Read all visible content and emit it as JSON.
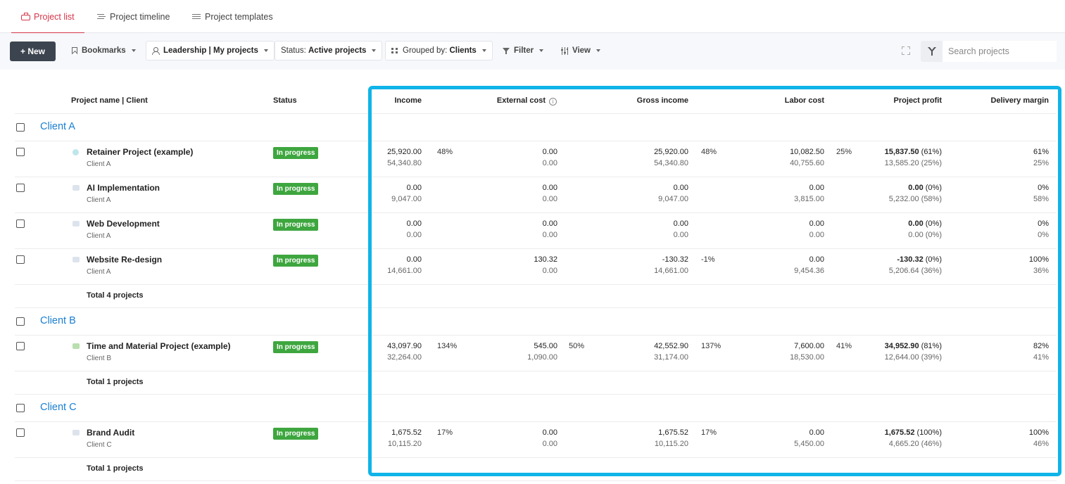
{
  "tabs": [
    {
      "label": "Project list",
      "icon": "briefcase-icon",
      "active": true
    },
    {
      "label": "Project timeline",
      "icon": "timeline-icon",
      "active": false
    },
    {
      "label": "Project templates",
      "icon": "list-icon",
      "active": false
    }
  ],
  "toolbar": {
    "new_label": "+ New",
    "bookmarks_label": "Bookmarks",
    "view_selector": "Leadership | My projects",
    "status_prefix": "Status: ",
    "status_value": "Active projects",
    "grouped_prefix": "Grouped by: ",
    "grouped_value": "Clients",
    "filter_label": "Filter",
    "view_label": "View",
    "search_placeholder": "Search projects"
  },
  "columns": {
    "name": "Project name | Client",
    "status": "Status",
    "income": "Income",
    "external_cost": "External cost",
    "gross_income": "Gross income",
    "labor_cost": "Labor cost",
    "project_profit": "Project profit",
    "delivery_margin": "Delivery margin"
  },
  "colors": {
    "accent": "#d6364b",
    "status_green": "#3ea63f",
    "client_link": "#1a7fd0",
    "highlight": "#0fb4e8"
  },
  "groups": [
    {
      "client": "Client A",
      "total": "Total 4 projects",
      "projects": [
        {
          "name": "Retainer Project (example)",
          "client": "Client A",
          "status": "In progress",
          "income": "25,920.00",
          "income_sub": "54,340.80",
          "income_pct": "48%",
          "ext": "0.00",
          "ext_sub": "0.00",
          "ext_pct": "",
          "gross": "25,920.00",
          "gross_sub": "54,340.80",
          "gross_pct": "48%",
          "labor": "10,082.50",
          "labor_sub": "40,755.60",
          "labor_pct": "25%",
          "profit": "15,837.50",
          "profit_pct": "(61%)",
          "profit_sub": "13,585.20 (25%)",
          "margin": "61%",
          "margin_sub": "25%"
        },
        {
          "name": "AI Implementation",
          "client": "Client A",
          "status": "In progress",
          "income": "0.00",
          "income_sub": "9,047.00",
          "income_pct": "",
          "ext": "0.00",
          "ext_sub": "0.00",
          "ext_pct": "",
          "gross": "0.00",
          "gross_sub": "9,047.00",
          "gross_pct": "",
          "labor": "0.00",
          "labor_sub": "3,815.00",
          "labor_pct": "",
          "profit": "0.00",
          "profit_pct": "(0%)",
          "profit_sub": "5,232.00 (58%)",
          "margin": "0%",
          "margin_sub": "58%"
        },
        {
          "name": "Web Development",
          "client": "Client A",
          "status": "In progress",
          "income": "0.00",
          "income_sub": "0.00",
          "income_pct": "",
          "ext": "0.00",
          "ext_sub": "0.00",
          "ext_pct": "",
          "gross": "0.00",
          "gross_sub": "0.00",
          "gross_pct": "",
          "labor": "0.00",
          "labor_sub": "0.00",
          "labor_pct": "",
          "profit": "0.00",
          "profit_pct": "(0%)",
          "profit_sub": "0.00 (0%)",
          "margin": "0%",
          "margin_sub": "0%"
        },
        {
          "name": "Website Re-design",
          "client": "Client A",
          "status": "In progress",
          "income": "0.00",
          "income_sub": "14,661.00",
          "income_pct": "",
          "ext": "130.32",
          "ext_sub": "0.00",
          "ext_pct": "",
          "gross": "-130.32",
          "gross_sub": "14,661.00",
          "gross_pct": "-1%",
          "labor": "0.00",
          "labor_sub": "9,454.36",
          "labor_pct": "",
          "profit": "-130.32",
          "profit_pct": "(0%)",
          "profit_sub": "5,206.64 (36%)",
          "margin": "100%",
          "margin_sub": "36%"
        }
      ]
    },
    {
      "client": "Client B",
      "total": "Total 1 projects",
      "projects": [
        {
          "name": "Time and Material Project (example)",
          "client": "Client B",
          "status": "In progress",
          "income": "43,097.90",
          "income_sub": "32,264.00",
          "income_pct": "134%",
          "ext": "545.00",
          "ext_sub": "1,090.00",
          "ext_pct": "50%",
          "gross": "42,552.90",
          "gross_sub": "31,174.00",
          "gross_pct": "137%",
          "labor": "7,600.00",
          "labor_sub": "18,530.00",
          "labor_pct": "41%",
          "profit": "34,952.90",
          "profit_pct": "(81%)",
          "profit_sub": "12,644.00 (39%)",
          "margin": "82%",
          "margin_sub": "41%"
        }
      ]
    },
    {
      "client": "Client C",
      "total": "Total 1 projects",
      "projects": [
        {
          "name": "Brand Audit",
          "client": "Client C",
          "status": "In progress",
          "income": "1,675.52",
          "income_sub": "10,115.20",
          "income_pct": "17%",
          "ext": "0.00",
          "ext_sub": "0.00",
          "ext_pct": "",
          "gross": "1,675.52",
          "gross_sub": "10,115.20",
          "gross_pct": "17%",
          "labor": "0.00",
          "labor_sub": "5,450.00",
          "labor_pct": "",
          "profit": "1,675.52",
          "profit_pct": "(100%)",
          "profit_sub": "4,665.20 (46%)",
          "margin": "100%",
          "margin_sub": "46%"
        }
      ]
    }
  ]
}
